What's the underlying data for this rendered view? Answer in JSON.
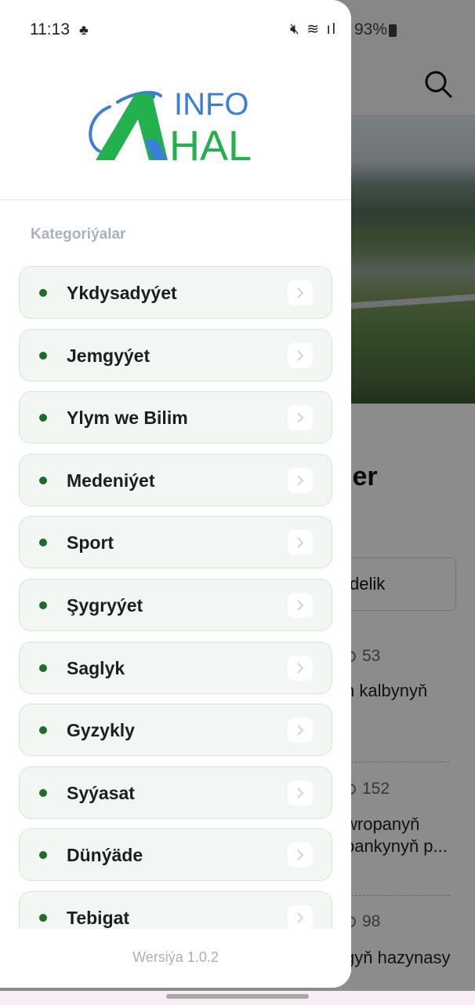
{
  "status_bar": {
    "time": "11:13",
    "battery": "93%"
  },
  "logo": {
    "text_top": "INFO",
    "text_bottom": "HAL"
  },
  "drawer": {
    "section_title": "Kategoriýalar",
    "categories": [
      {
        "label": "Ykdysadyýet"
      },
      {
        "label": "Jemgyýet"
      },
      {
        "label": "Ylym we Bilim"
      },
      {
        "label": "Medeniýet"
      },
      {
        "label": "Sport"
      },
      {
        "label": "Şygryýet"
      },
      {
        "label": "Saglyk"
      },
      {
        "label": "Gyzykly"
      },
      {
        "label": "Syýasat"
      },
      {
        "label": "Dünýäde"
      },
      {
        "label": "Tebigat"
      }
    ],
    "version": "Wersiýa 1.0.2"
  },
  "background": {
    "heading_partial": "ler",
    "filter_partial": "delik",
    "articles": [
      {
        "views": "53",
        "title_partial": "n kalbynyň"
      },
      {
        "views": "152",
        "title_partial_1": "wropanyň",
        "title_partial_2": "bankynyň p..."
      },
      {
        "views": "98",
        "title_partial": "gyň hazynasy"
      }
    ]
  },
  "colors": {
    "brand_green": "#22b14c",
    "brand_blue": "#3b7fd6",
    "dot_green": "#1f6b2a",
    "item_bg": "#f3f7f3"
  }
}
